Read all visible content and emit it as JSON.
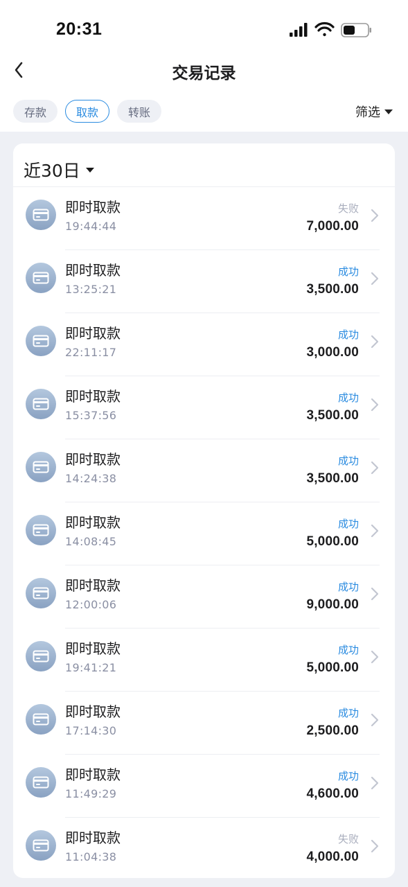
{
  "status_bar": {
    "time": "20:31"
  },
  "header": {
    "title": "交易记录",
    "back_icon": "chevron-left-icon"
  },
  "filter_tabs": [
    {
      "label": "存款",
      "active": false
    },
    {
      "label": "取款",
      "active": true
    },
    {
      "label": "转账",
      "active": false
    }
  ],
  "filter_button": {
    "label": "筛选"
  },
  "period_selector": {
    "label": "近30日"
  },
  "colors": {
    "accent": "#2a8be0",
    "failed": "#a9aebd",
    "background": "#eef0f5"
  },
  "transactions": [
    {
      "title": "即时取款",
      "time": "19:44:44",
      "status": "失败",
      "status_type": "fail",
      "amount": "7,000.00"
    },
    {
      "title": "即时取款",
      "time": "13:25:21",
      "status": "成功",
      "status_type": "ok",
      "amount": "3,500.00"
    },
    {
      "title": "即时取款",
      "time": "22:11:17",
      "status": "成功",
      "status_type": "ok",
      "amount": "3,000.00"
    },
    {
      "title": "即时取款",
      "time": "15:37:56",
      "status": "成功",
      "status_type": "ok",
      "amount": "3,500.00"
    },
    {
      "title": "即时取款",
      "time": "14:24:38",
      "status": "成功",
      "status_type": "ok",
      "amount": "3,500.00"
    },
    {
      "title": "即时取款",
      "time": "14:08:45",
      "status": "成功",
      "status_type": "ok",
      "amount": "5,000.00"
    },
    {
      "title": "即时取款",
      "time": "12:00:06",
      "status": "成功",
      "status_type": "ok",
      "amount": "9,000.00"
    },
    {
      "title": "即时取款",
      "time": "19:41:21",
      "status": "成功",
      "status_type": "ok",
      "amount": "5,000.00"
    },
    {
      "title": "即时取款",
      "time": "17:14:30",
      "status": "成功",
      "status_type": "ok",
      "amount": "2,500.00"
    },
    {
      "title": "即时取款",
      "time": "11:49:29",
      "status": "成功",
      "status_type": "ok",
      "amount": "4,600.00"
    },
    {
      "title": "即时取款",
      "time": "11:04:38",
      "status": "失败",
      "status_type": "fail",
      "amount": "4,000.00"
    }
  ]
}
